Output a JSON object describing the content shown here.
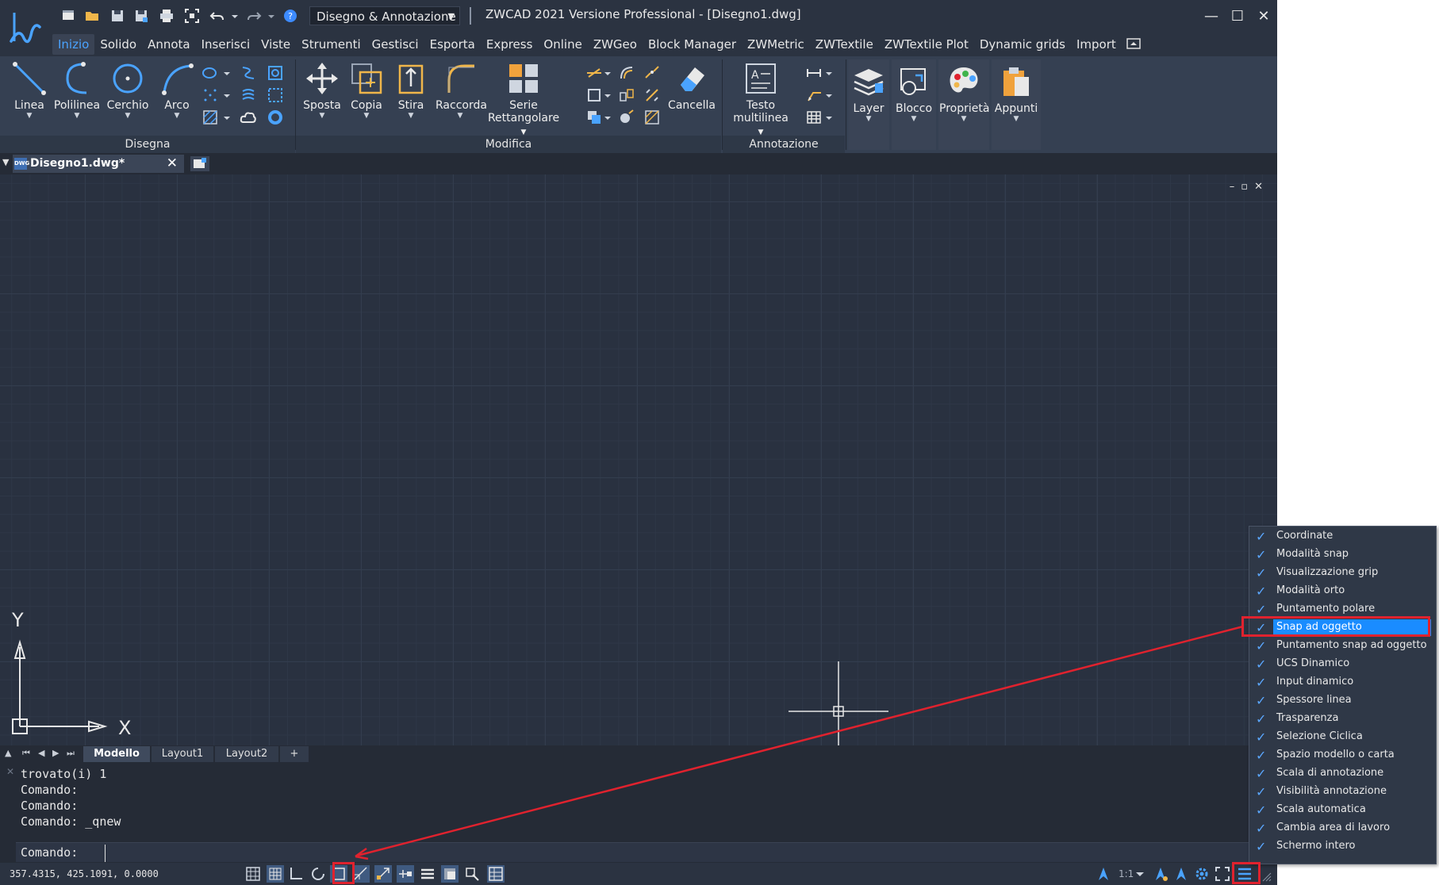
{
  "window": {
    "title": "ZWCAD 2021 Versione Professional - [Disegno1.dwg]",
    "workspace": "Disegno & Annotazione",
    "minimize": "—",
    "maximize": "☐",
    "close": "✕"
  },
  "menu": [
    "Inizio",
    "Solido",
    "Annota",
    "Inserisci",
    "Viste",
    "Strumenti",
    "Gestisci",
    "Esporta",
    "Express",
    "Online",
    "ZWGeo",
    "Block Manager",
    "ZWMetric",
    "ZWTextile",
    "ZWTextile Plot",
    "Dynamic grids",
    "Import"
  ],
  "ribbon": {
    "panels": {
      "draw": "Disegna",
      "modify": "Modifica",
      "annotation": "Annotazione"
    },
    "tools": {
      "line": "Linea",
      "polyline": "Polilinea",
      "circle": "Cerchio",
      "arc": "Arco",
      "move": "Sposta",
      "copy": "Copia",
      "stretch": "Stira",
      "fillet": "Raccorda",
      "array_1": "Serie",
      "array_2": "Rettangolare",
      "erase": "Cancella",
      "mtext_1": "Testo",
      "mtext_2": "multilinea",
      "layer": "Layer",
      "block": "Blocco",
      "properties": "Proprietà",
      "clipboard": "Appunti"
    }
  },
  "document_tab": {
    "name": "Disegno1.dwg*",
    "icon_text": "DWG",
    "close": "✕"
  },
  "viewport_controls": "–▫✕",
  "ucs": {
    "x_label": "X",
    "y_label": "Y"
  },
  "layout_tabs": [
    "Modello",
    "Layout1",
    "Layout2",
    "+"
  ],
  "command_history": [
    "trovato(i) 1",
    "Comando:",
    "Comando:",
    "Comando: _qnew"
  ],
  "command_prompt": "Comando:",
  "command_input": "",
  "status": {
    "coords": "357.4315, 425.1091, 0.0000",
    "scale": "1:1"
  },
  "context_menu": [
    {
      "label": "Coordinate",
      "checked": true
    },
    {
      "label": "Modalità snap",
      "checked": true
    },
    {
      "label": "Visualizzazione grip",
      "checked": true
    },
    {
      "label": "Modalità orto",
      "checked": true
    },
    {
      "label": "Puntamento polare",
      "checked": true
    },
    {
      "label": "Snap ad oggetto",
      "checked": true,
      "selected": true
    },
    {
      "label": "Puntamento snap ad oggetto",
      "checked": true
    },
    {
      "label": "UCS Dinamico",
      "checked": true
    },
    {
      "label": "Input dinamico",
      "checked": true
    },
    {
      "label": "Spessore linea",
      "checked": true
    },
    {
      "label": "Trasparenza",
      "checked": true
    },
    {
      "label": "Selezione Ciclica",
      "checked": true
    },
    {
      "label": "Spazio modello o carta",
      "checked": true
    },
    {
      "label": "Scala di annotazione",
      "checked": true
    },
    {
      "label": "Visibilità annotazione",
      "checked": true
    },
    {
      "label": "Scala automatica",
      "checked": true
    },
    {
      "label": "Cambia area di lavoro",
      "checked": true
    },
    {
      "label": "Schermo intero",
      "checked": true
    }
  ],
  "colors": {
    "accent": "#4aa3ff",
    "selection": "#1a8cff",
    "highlight_red": "#e0222e",
    "canvas": "#293140"
  }
}
